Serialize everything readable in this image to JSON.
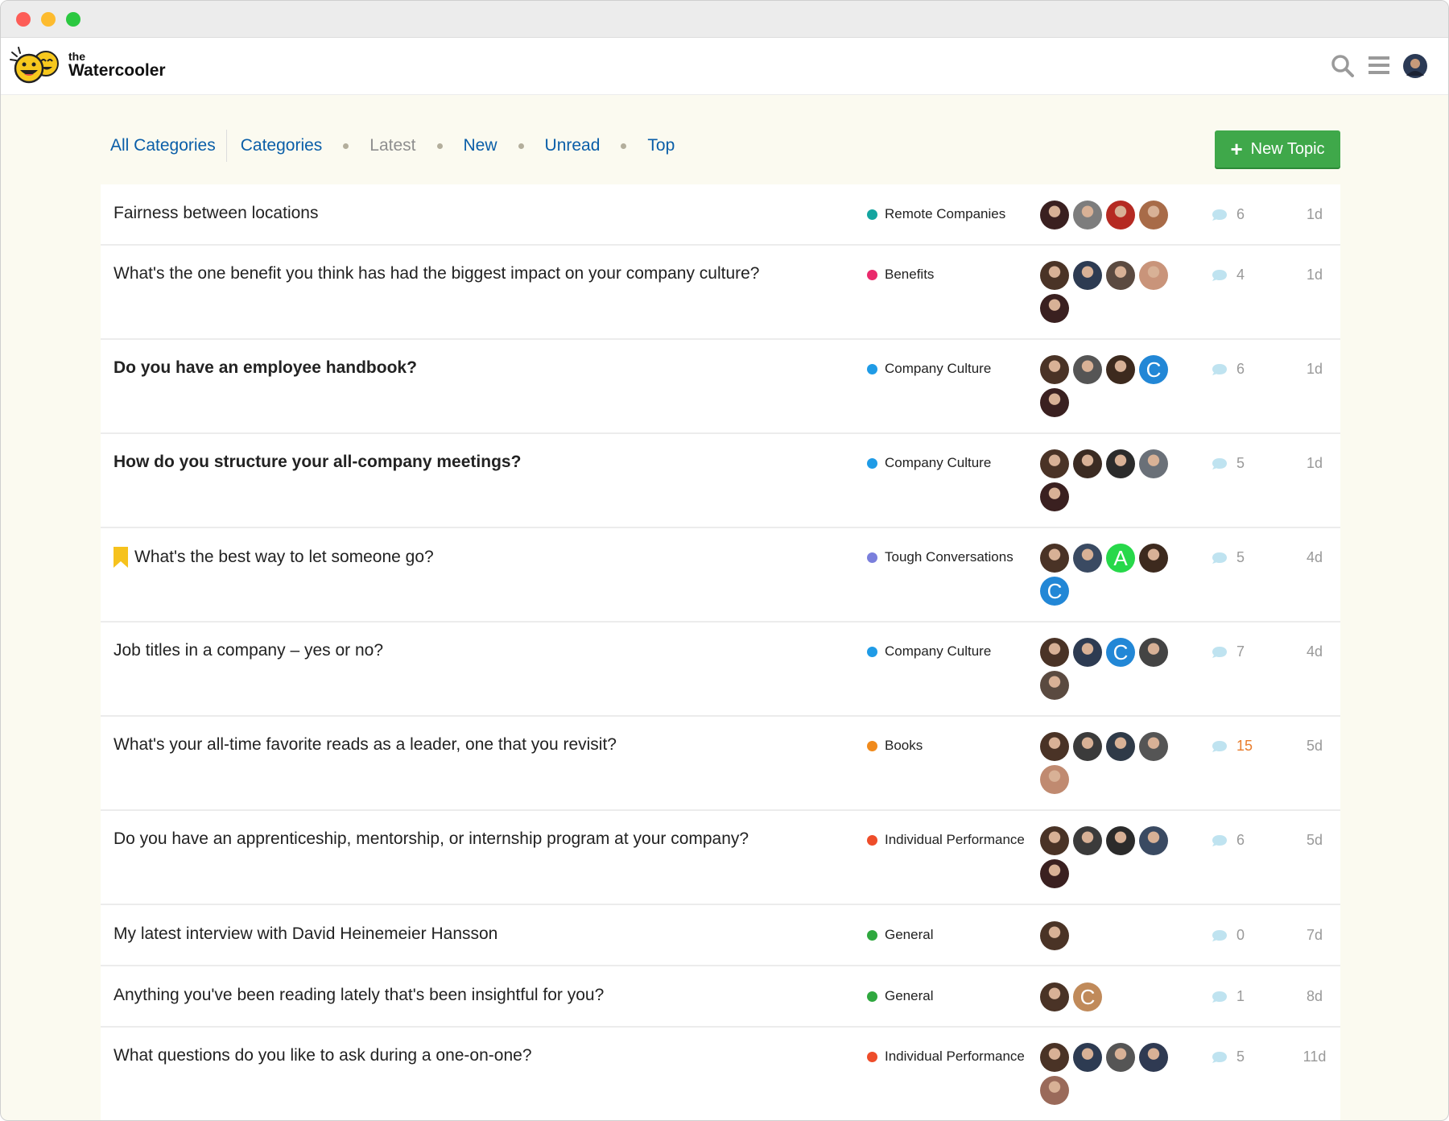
{
  "brand": {
    "the": "the",
    "name": "Watercooler"
  },
  "nav": {
    "all_categories": "All Categories",
    "categories": "Categories",
    "latest": "Latest",
    "new": "New",
    "unread": "Unread",
    "top": "Top"
  },
  "new_topic_label": "New Topic",
  "topics": [
    {
      "title": "Fairness between locations",
      "bold": false,
      "bookmarked": false,
      "category": "Remote Companies",
      "category_color": "#14a5a0",
      "posters": [
        "#3a2020",
        "#7d7d7d",
        "#b52a22",
        "#a86b48"
      ],
      "replies": "6",
      "age": "1d"
    },
    {
      "title": "What's the one benefit you think has had the biggest impact on your company culture?",
      "bold": false,
      "bookmarked": false,
      "category": "Benefits",
      "category_color": "#ea2a6c",
      "posters": [
        "#4a3326",
        "#2d3b52",
        "#5b4a40",
        "#c9947a",
        "#3a2020"
      ],
      "replies": "4",
      "age": "1d"
    },
    {
      "title": "Do you have an employee handbook?",
      "bold": true,
      "bookmarked": false,
      "category": "Company Culture",
      "category_color": "#1f9be6",
      "posters": [
        "#4a3326",
        "#555555",
        "#3d2a1e",
        {
          "letter": "C",
          "color": "#2287d6"
        },
        "#3a2020"
      ],
      "replies": "6",
      "age": "1d"
    },
    {
      "title": "How do you structure your all-company meetings?",
      "bold": true,
      "bookmarked": false,
      "category": "Company Culture",
      "category_color": "#1f9be6",
      "posters": [
        "#4a3326",
        "#3b2b22",
        "#2b2b2b",
        "#6a7078",
        "#3a2020"
      ],
      "replies": "5",
      "age": "1d"
    },
    {
      "title": "What's the best way to let someone go?",
      "bold": false,
      "bookmarked": true,
      "category": "Tough Conversations",
      "category_color": "#7a7fdc",
      "posters": [
        "#4a3326",
        "#3a4a62",
        {
          "letter": "A",
          "color": "#27d84a"
        },
        "#3d2a1e",
        {
          "letter": "C",
          "color": "#2287d6"
        }
      ],
      "replies": "5",
      "age": "4d"
    },
    {
      "title": "Job titles in a company – yes or no?",
      "bold": false,
      "bookmarked": false,
      "category": "Company Culture",
      "category_color": "#1f9be6",
      "posters": [
        "#4a3326",
        "#2d3b52",
        {
          "letter": "C",
          "color": "#2287d6"
        },
        "#444444",
        "#5a4a40"
      ],
      "replies": "7",
      "age": "4d"
    },
    {
      "title": "What's your all-time favorite reads as a leader, one that you revisit?",
      "bold": false,
      "bookmarked": false,
      "category": "Books",
      "category_color": "#f08a1c",
      "posters": [
        "#4a3326",
        "#3b3b3b",
        "#2f3a48",
        "#555555",
        "#c08a70"
      ],
      "replies": "15",
      "hot": true,
      "age": "5d"
    },
    {
      "title": "Do you have an apprenticeship, mentorship, or internship program at your company?",
      "bold": false,
      "bookmarked": false,
      "category": "Individual Performance",
      "category_color": "#ee4d2a",
      "posters": [
        "#4a3326",
        "#3b3b3b",
        "#2b2b2b",
        "#3a4a62",
        "#3a2020"
      ],
      "replies": "6",
      "age": "5d"
    },
    {
      "title": "My latest interview with David Heinemeier Hansson",
      "bold": false,
      "bookmarked": false,
      "category": "General",
      "category_color": "#2fa83f",
      "posters": [
        "#4a3326"
      ],
      "replies": "0",
      "age": "7d"
    },
    {
      "title": "Anything you've been reading lately that's been insightful for you?",
      "bold": false,
      "bookmarked": false,
      "category": "General",
      "category_color": "#2fa83f",
      "posters": [
        "#4a3326",
        {
          "letter": "C",
          "color": "#c08a5a"
        }
      ],
      "replies": "1",
      "age": "8d"
    },
    {
      "title": "What questions do you like to ask during a one-on-one?",
      "bold": false,
      "bookmarked": false,
      "category": "Individual Performance",
      "category_color": "#ee4d2a",
      "posters": [
        "#4a3326",
        "#2d3b52",
        "#555555",
        "#2f3a52",
        "#9a6a5a"
      ],
      "replies": "5",
      "age": "11d"
    }
  ]
}
